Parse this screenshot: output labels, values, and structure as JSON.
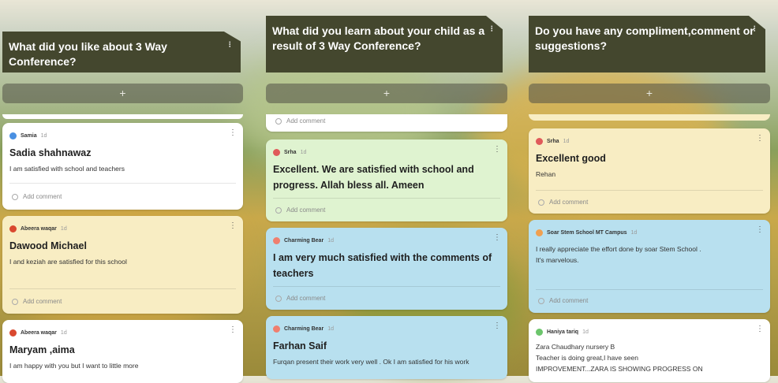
{
  "columns": [
    {
      "title": "What did you like about 3 Way Conference?",
      "menu_glyph": "⁝",
      "add_label": "+",
      "cards": [
        {
          "author": "Samia",
          "time": "1d",
          "avatar_color": "#4a90e2",
          "title": "Sadia shahnawaz",
          "body": "I am satisfied with school and teachers",
          "comment": "Add comment"
        },
        {
          "author": "Abeera waqar",
          "time": "1d",
          "avatar_color": "#d9482f",
          "title": "Dawood Michael",
          "body": "I and keziah are satisfied for this school",
          "comment": "Add comment"
        },
        {
          "author": "Abeera waqar",
          "time": "1d",
          "avatar_color": "#d9482f",
          "title": "Maryam ,aima",
          "body": "I am happy with you but I want to little  more"
        }
      ]
    },
    {
      "title": "What did you learn about your child as a result of 3 Way Conference?",
      "menu_glyph": "⁝",
      "add_label": "+",
      "top_comment": "Add comment",
      "cards": [
        {
          "author": "Srha",
          "time": "1d",
          "avatar_color": "#e05a5a",
          "title": "Excellent. We are satisfied with school and progress. Allah bless all. Ameen",
          "comment": "Add comment"
        },
        {
          "author": "Charming Bear",
          "time": "1d",
          "avatar_color": "#ef7f6f",
          "title": "I am very much satisfied with the comments of teachers",
          "comment": "Add comment"
        },
        {
          "author": "Charming Bear",
          "time": "1d",
          "avatar_color": "#ef7f6f",
          "title": "Farhan Saif",
          "body": "Furqan present their work very well . Ok I am satisfied for his work"
        }
      ]
    },
    {
      "title": "Do you have any compliment,comment or suggestions?",
      "menu_glyph": "⁝",
      "add_label": "+",
      "cards": [
        {
          "author": "Srha",
          "time": "1d",
          "avatar_color": "#e05a5a",
          "title": "Excellent good",
          "body": "Rehan",
          "comment": "Add comment"
        },
        {
          "author": "Soar Stem School MT Campus",
          "time": "1d",
          "avatar_color": "#f0a050",
          "body": "I really appreciate the effort done by soar Stem School .\nIt's marvelous.",
          "comment": "Add comment"
        },
        {
          "author": "Haniya tariq",
          "time": "1d",
          "avatar_color": "#6cc56c",
          "body": "Zara Chaudhary nursery B\nTeacher is doing great,I have seen\nIMPROVEMENT...ZARA IS SHOWING PROGRESS ON"
        }
      ]
    }
  ],
  "colors": {
    "header_bg": "#44472e",
    "card_white": "#ffffff",
    "card_cream": "#f8edc3",
    "card_green": "#dff3d0",
    "card_blue": "#b8e0ef"
  },
  "icons": {
    "comment": "comment-circle-icon",
    "menu": "kebab-menu-icon",
    "add": "plus-icon"
  }
}
